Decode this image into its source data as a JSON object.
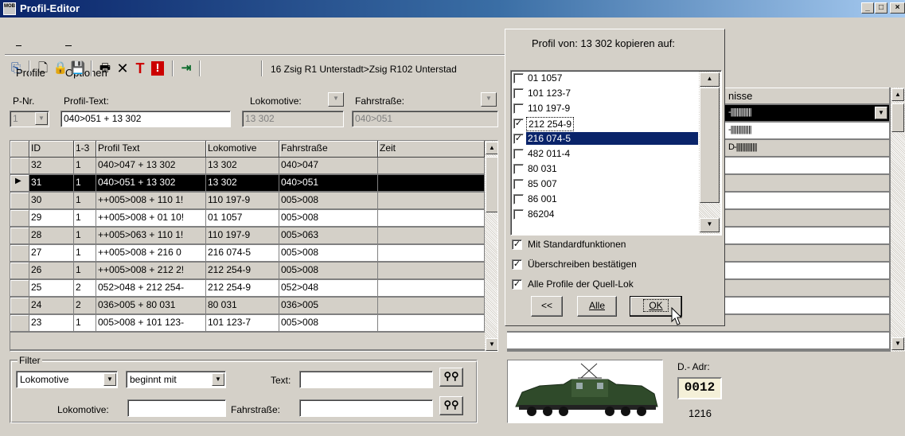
{
  "window": {
    "title": "Profil-Editor",
    "icon_text": "MOB"
  },
  "menu": [
    {
      "label": "Profile"
    },
    {
      "label": "Optionen"
    }
  ],
  "toolbar": {
    "route_text": "16 Zsig R1 Unterstadt>Zsig R102 Unterstad"
  },
  "fields": {
    "pnr_label": "P-Nr.",
    "pnr_value": "1",
    "profiltext_label": "Profil-Text:",
    "profiltext_value": "040>051 + 13 302",
    "lok_label": "Lokomotive:",
    "lok_value": "13 302",
    "fahr_label": "Fahrstraße:",
    "fahr_value": "040>051"
  },
  "grid": {
    "columns": [
      "ID",
      "1-3",
      "Profil Text",
      "Lokomotive",
      "Fahrstraße",
      "Zeit"
    ],
    "rows": [
      {
        "id": "32",
        "n": "1",
        "text": "040>047 + 13 302",
        "lok": "13 302",
        "fahr": "040>047",
        "zeit": ""
      },
      {
        "id": "31",
        "n": "1",
        "text": "040>051 + 13 302",
        "lok": "13 302",
        "fahr": "040>051",
        "zeit": ""
      },
      {
        "id": "30",
        "n": "1",
        "text": "++005>008 + 110 1!",
        "lok": "110 197-9",
        "fahr": "005>008",
        "zeit": ""
      },
      {
        "id": "29",
        "n": "1",
        "text": "++005>008 + 01 10!",
        "lok": "01 1057",
        "fahr": "005>008",
        "zeit": ""
      },
      {
        "id": "28",
        "n": "1",
        "text": "++005>063 + 110 1!",
        "lok": "110 197-9",
        "fahr": "005>063",
        "zeit": ""
      },
      {
        "id": "27",
        "n": "1",
        "text": "++005>008 + 216 0",
        "lok": "216 074-5",
        "fahr": "005>008",
        "zeit": ""
      },
      {
        "id": "26",
        "n": "1",
        "text": "++005>008 + 212 2!",
        "lok": "212 254-9",
        "fahr": "005>008",
        "zeit": ""
      },
      {
        "id": "25",
        "n": "2",
        "text": "052>048 + 212 254-",
        "lok": "212 254-9",
        "fahr": "052>048",
        "zeit": ""
      },
      {
        "id": "24",
        "n": "2",
        "text": "036>005 + 80 031",
        "lok": "80 031",
        "fahr": "036>005",
        "zeit": ""
      },
      {
        "id": "23",
        "n": "1",
        "text": "005>008 + 101 123-",
        "lok": "101 123-7",
        "fahr": "005>008",
        "zeit": ""
      }
    ],
    "selected_row": 1
  },
  "copy_popup": {
    "title": "Profil von: 13 302 kopieren auf:",
    "items": [
      {
        "label": "01 1057",
        "checked": false
      },
      {
        "label": "101 123-7",
        "checked": false
      },
      {
        "label": "110 197-9",
        "checked": false
      },
      {
        "label": "212 254-9",
        "checked": true
      },
      {
        "label": "216 074-5",
        "checked": true
      },
      {
        "label": "482 011-4",
        "checked": false
      },
      {
        "label": "80 031",
        "checked": false
      },
      {
        "label": "85 007",
        "checked": false
      },
      {
        "label": "86 001",
        "checked": false
      },
      {
        "label": "86204",
        "checked": false
      }
    ],
    "options": [
      {
        "label": "Mit Standardfunktionen",
        "checked": true
      },
      {
        "label": "Überschreiben bestätigen",
        "checked": true
      },
      {
        "label": "Alle Profile der Quell-Lok",
        "checked": true
      }
    ],
    "btn_back": "<<",
    "btn_all": "Alle",
    "btn_ok": "OK"
  },
  "right_panel": {
    "header_partial": "nisse",
    "row1_partial": "-||||||||||||||",
    "row2_partial": "-||||||||||||||",
    "row3_partial": "D-||||||||||||||"
  },
  "filter": {
    "legend": "Filter",
    "field_select": "Lokomotive",
    "mode_select": "beginnt mit",
    "text_label": "Text:",
    "lok_label": "Lokomotive:",
    "fahr_label": "Fahrstraße:"
  },
  "loco_info": {
    "dadr_label": "D.- Adr:",
    "dadr_value": "0012",
    "number": "1216"
  }
}
